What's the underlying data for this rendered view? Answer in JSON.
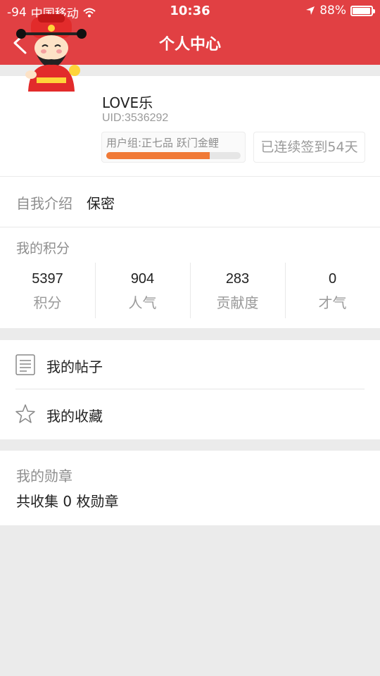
{
  "status_bar": {
    "signal": "-94",
    "carrier": "中国移动",
    "time": "10:36",
    "battery": "88%",
    "battery_level": 0.88
  },
  "nav": {
    "title": "个人中心"
  },
  "profile": {
    "username": "LOVE乐",
    "uid": "UID:3536292",
    "group": "用户组:正七品   跃门金鲤",
    "group_progress": 0.77,
    "signin": "已连续签到54天"
  },
  "intro": {
    "label": "自我介绍",
    "value": "保密"
  },
  "points": {
    "title": "我的积分",
    "stats": [
      {
        "value": "5397",
        "label": "积分"
      },
      {
        "value": "904",
        "label": "人气"
      },
      {
        "value": "283",
        "label": "贡献度"
      },
      {
        "value": "0",
        "label": "才气"
      }
    ]
  },
  "menu": [
    {
      "label": "我的帖子",
      "icon": "document-icon"
    },
    {
      "label": "我的收藏",
      "icon": "star-icon"
    }
  ],
  "medals": {
    "title": "我的勋章",
    "count_text": "共收集 0 枚勋章"
  },
  "colors": {
    "header": "#e14043",
    "progress": "#f07a37"
  }
}
